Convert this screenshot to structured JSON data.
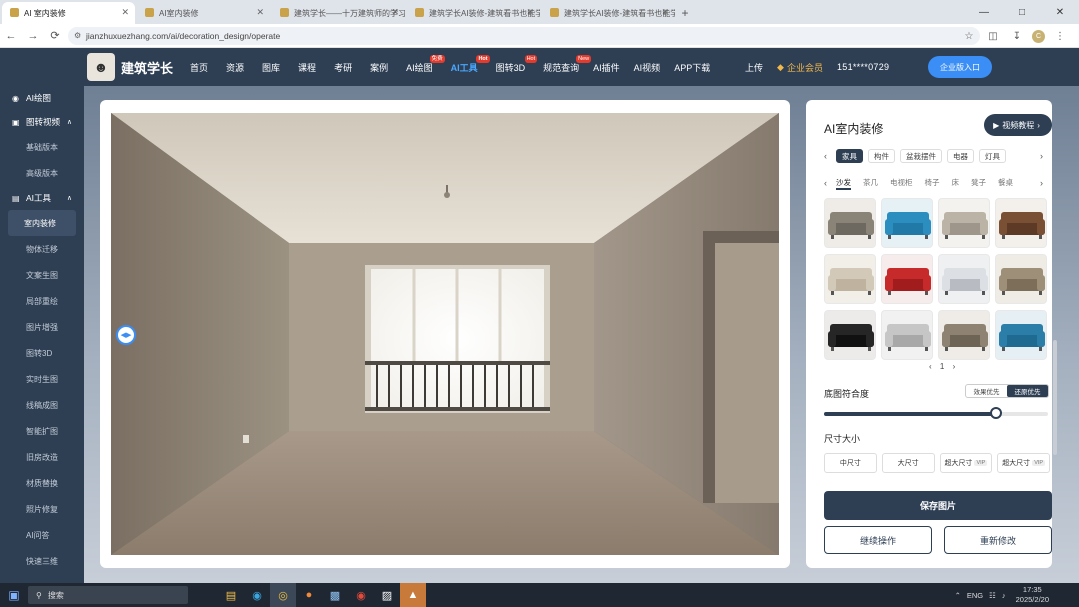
{
  "browser": {
    "tabs": [
      {
        "title": "AI 室内装修",
        "active": true
      },
      {
        "title": "AI室内装修",
        "active": false
      },
      {
        "title": "建筑学长——十万建筑师的学习…",
        "active": false
      },
      {
        "title": "建筑学长AI装修-建筑看书也能学…",
        "active": false
      },
      {
        "title": "建筑学长AI装修-建筑看书也能学…",
        "active": false
      }
    ],
    "url": "jianzhuxuezhang.com/ai/decoration_design/operate",
    "window_controls": [
      "minimize-icon",
      "maximize-icon",
      "close-icon"
    ]
  },
  "site": {
    "logo_text": "建筑学长",
    "nav": [
      {
        "label": "首页"
      },
      {
        "label": "资源"
      },
      {
        "label": "图库"
      },
      {
        "label": "课程"
      },
      {
        "label": "考研"
      },
      {
        "label": "案例"
      },
      {
        "label": "AI绘图",
        "badge": "免费"
      },
      {
        "label": "AI工具",
        "badge": "Hot",
        "active": true
      },
      {
        "label": "图转3D",
        "badge": "Hot"
      },
      {
        "label": "规范查询",
        "badge": "New"
      },
      {
        "label": "AI插件"
      },
      {
        "label": "AI视频"
      },
      {
        "label": "APP下载"
      }
    ],
    "upload": "上传",
    "vip": "企业会员",
    "phone": "151****0729",
    "enterprise_button": "企业版入口"
  },
  "sidebar": {
    "sections": [
      {
        "label": "AI绘图",
        "icon": "eye-icon",
        "collapsible": false,
        "items": []
      },
      {
        "label": "图转视频",
        "icon": "video-icon",
        "collapsible": true,
        "items": [
          {
            "label": "基础版本"
          },
          {
            "label": "高级版本"
          }
        ]
      },
      {
        "label": "AI工具",
        "icon": "toolbox-icon",
        "collapsible": true,
        "items": [
          {
            "label": "室内装修",
            "active": true
          },
          {
            "label": "物体迁移"
          },
          {
            "label": "文案生图"
          },
          {
            "label": "局部重绘"
          },
          {
            "label": "图片增强"
          },
          {
            "label": "图转3D"
          },
          {
            "label": "实时生图"
          },
          {
            "label": "线稿成图"
          },
          {
            "label": "智能扩图"
          },
          {
            "label": "旧房改造"
          },
          {
            "label": "材质替换"
          },
          {
            "label": "照片修复"
          },
          {
            "label": "AI问答"
          },
          {
            "label": "快速三维"
          }
        ]
      }
    ]
  },
  "panel": {
    "title": "AI室内装修",
    "tutorial_button": "视频教程",
    "categories": [
      {
        "label": "家具",
        "active": true
      },
      {
        "label": "构件"
      },
      {
        "label": "盆栽摆件"
      },
      {
        "label": "电器"
      },
      {
        "label": "灯具"
      }
    ],
    "subcategories": [
      {
        "label": "沙发",
        "active": true
      },
      {
        "label": "茶几"
      },
      {
        "label": "电视柜"
      },
      {
        "label": "椅子"
      },
      {
        "label": "床"
      },
      {
        "label": "凳子"
      },
      {
        "label": "餐桌"
      }
    ],
    "products": [
      {
        "name": "grey-sofa-a",
        "bg": "#efece8",
        "fg": "#8a8478",
        "seat": "#6d6860"
      },
      {
        "name": "blue-sofa-a",
        "bg": "#e6f1f6",
        "fg": "#2c8dbf",
        "seat": "#2179a8"
      },
      {
        "name": "grey-sofa-b",
        "bg": "#f4f2ef",
        "fg": "#bbb3a6",
        "seat": "#9e968a"
      },
      {
        "name": "brown-sofa",
        "bg": "#f3efea",
        "fg": "#7a5035",
        "seat": "#5c3a26"
      },
      {
        "name": "beige-sofa",
        "bg": "#f2efe9",
        "fg": "#d3c9b8",
        "seat": "#bfb3a0"
      },
      {
        "name": "red-sofa",
        "bg": "#f7ecec",
        "fg": "#c72a2a",
        "seat": "#a11c1c"
      },
      {
        "name": "white-sofa",
        "bg": "#eef0f2",
        "fg": "#dcdfe3",
        "seat": "#b8bcc2"
      },
      {
        "name": "pattern-sofa",
        "bg": "#efebe5",
        "fg": "#9e8f78",
        "seat": "#7c6e58"
      },
      {
        "name": "black-sofa",
        "bg": "#ecebea",
        "fg": "#262626",
        "seat": "#111111"
      },
      {
        "name": "light-grey-sofa",
        "bg": "#f1f1f1",
        "fg": "#c6c6c6",
        "seat": "#a8a8a8"
      },
      {
        "name": "taupe-sofa",
        "bg": "#efece7",
        "fg": "#8e8373",
        "seat": "#6e6456"
      },
      {
        "name": "teal-sofa",
        "bg": "#e6f0f4",
        "fg": "#2a7ea8",
        "seat": "#1e6a90"
      }
    ],
    "page": "1",
    "blend_label": "底图符合度",
    "blend_modes": [
      {
        "label": "效果优先"
      },
      {
        "label": "还原优先",
        "active": true
      }
    ],
    "blend_value": 0.77,
    "size_label": "尺寸大小",
    "sizes": [
      {
        "label": "中尺寸"
      },
      {
        "label": "大尺寸"
      },
      {
        "label": "超大尺寸",
        "tag": "VIP"
      },
      {
        "label": "超大尺寸",
        "tag": "VIP"
      }
    ],
    "save_button": "保存图片",
    "continue_button": "继续操作",
    "redo_button": "重新修改"
  },
  "taskbar": {
    "search": "搜索",
    "lang": "ENG",
    "time": "17:35",
    "date": "2025/2/20"
  },
  "colors": {
    "header_bg": "#2e3f54",
    "accent": "#3a8ef5",
    "badge_red": "#e23b2e"
  }
}
